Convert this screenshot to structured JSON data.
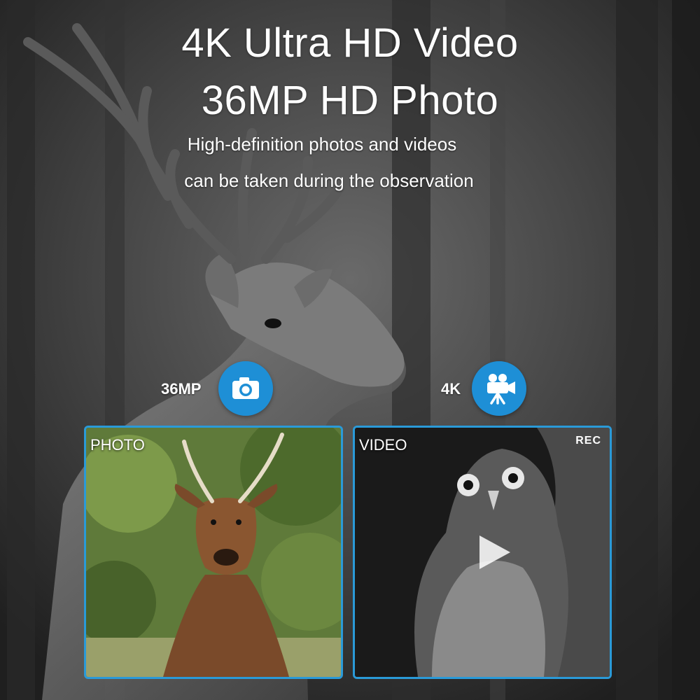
{
  "headline": {
    "line1": "4K Ultra HD Video",
    "line2": "36MP HD Photo"
  },
  "subtitle": {
    "line1": "High-definition photos and videos",
    "line2": "can be taken during the observation"
  },
  "features": {
    "photo_spec": "36MP",
    "video_spec": "4K"
  },
  "panels": {
    "photo_label": "PHOTO",
    "video_label": "VIDEO",
    "rec_label": "REC"
  },
  "colors": {
    "accent": "#1e8fd6",
    "panel_border": "#2a9ad8"
  },
  "icons": {
    "photo": "camera-icon",
    "video": "video-camera-icon",
    "play": "play-icon"
  }
}
